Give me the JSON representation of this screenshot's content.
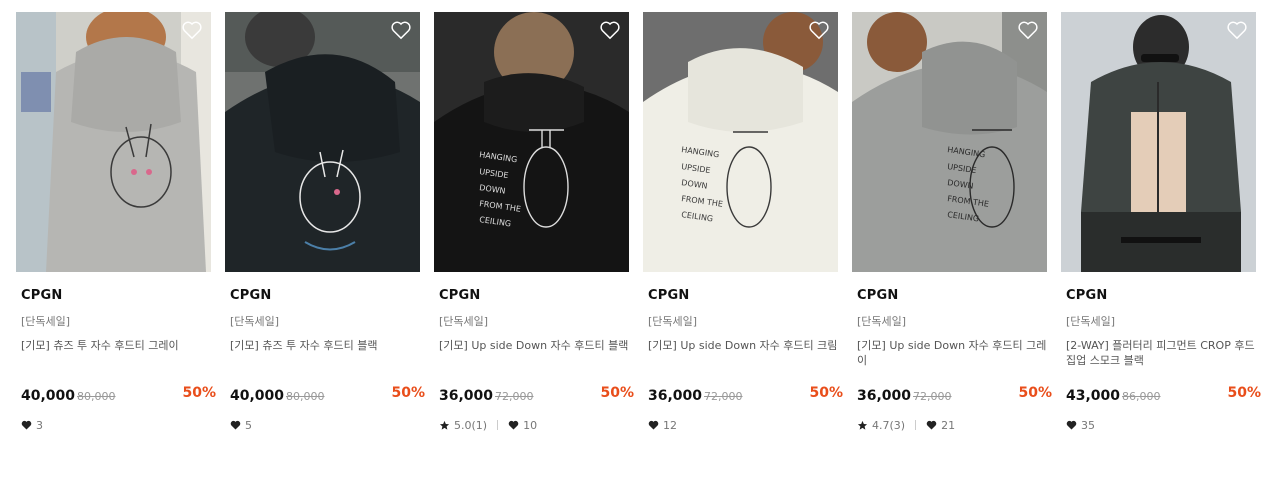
{
  "products": [
    {
      "brand": "CPGN",
      "tag": "[단독세일]",
      "name": "[기모] 츄즈 투 자수 후드티 그레이",
      "price": "40,000",
      "original": "80,000",
      "discount": "50%",
      "rating": "",
      "likes": "3"
    },
    {
      "brand": "CPGN",
      "tag": "[단독세일]",
      "name": "[기모] 츄즈 투 자수 후드티 블랙",
      "price": "40,000",
      "original": "80,000",
      "discount": "50%",
      "rating": "",
      "likes": "5"
    },
    {
      "brand": "CPGN",
      "tag": "[단독세일]",
      "name": "[기모] Up side Down 자수 후드티 블랙",
      "price": "36,000",
      "original": "72,000",
      "discount": "50%",
      "rating": "5.0(1)",
      "likes": "10"
    },
    {
      "brand": "CPGN",
      "tag": "[단독세일]",
      "name": "[기모] Up side Down 자수 후드티 크림",
      "price": "36,000",
      "original": "72,000",
      "discount": "50%",
      "rating": "",
      "likes": "12"
    },
    {
      "brand": "CPGN",
      "tag": "[단독세일]",
      "name": "[기모] Up side Down 자수 후드티 그레이",
      "price": "36,000",
      "original": "72,000",
      "discount": "50%",
      "rating": "4.7(3)",
      "likes": "21"
    },
    {
      "brand": "CPGN",
      "tag": "[단독세일]",
      "name": "[2-WAY] 플러터리 피그먼트 CROP 후드 집업 스모크 블랙",
      "price": "43,000",
      "original": "86,000",
      "discount": "50%",
      "rating": "",
      "likes": "35"
    }
  ],
  "colors": {
    "discount": "#e94e1b",
    "price": "#111111",
    "muted": "#777777"
  },
  "icons": {
    "wishlist": "heart-outline-icon",
    "like": "heart-icon",
    "rating": "star-icon"
  }
}
